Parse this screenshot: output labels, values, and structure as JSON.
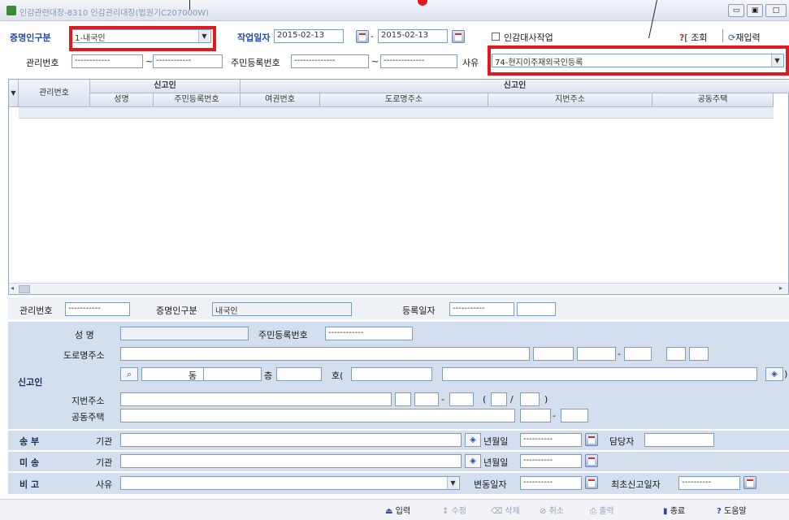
{
  "window": {
    "title": "인감관련대장-8310 인감관리대장(법원기C207000W)"
  },
  "top": {
    "cert_label": "증명인구분",
    "cert_value": "1-내국인",
    "workdate_label": "작업일자",
    "date_from": "2015-02-13",
    "date_sep": "-",
    "date_to": "2015-02-13",
    "seal_checkbox_label": "인감대사작업",
    "query_label": "조회",
    "reinput_label": "재입력",
    "mgmt_label": "관리번호",
    "mgmt_a": "------------",
    "mgmt_sep": "~",
    "mgmt_b": "------------",
    "rrn_label": "주민등록번호",
    "rrn_a": "--------------",
    "rrn_sep": "~",
    "rrn_b": "--------------",
    "reason_label": "사유",
    "reason_value": "74-현지이주재외국인등록"
  },
  "grid": {
    "group_reporter1": "신고인",
    "group_reporter2": "신고인",
    "col_mgmt": "관리번호",
    "col_name": "성명",
    "col_rrn": "주민등록번호",
    "col_passport": "여권번호",
    "col_road": "도로명주소",
    "col_lot": "지번주소",
    "col_apt": "공동주택"
  },
  "detail": {
    "mgmt_label": "관리번호",
    "mgmt_value": "-----------",
    "cert_label": "증명인구분",
    "cert_value": "내국인",
    "regdate_label": "등록일자",
    "regdate_value": "-----------",
    "reporter_label": "신고인",
    "name_label": "성      명",
    "rrn_label": "주민등록번호",
    "rrn_value": "------------",
    "road_label": "도로명주소",
    "road_sep": "-",
    "dong_label": "동",
    "floor_label": "층",
    "ho_label": "호(",
    "lot_label": "지번주소",
    "lot_sep": "-",
    "paren_open": "(",
    "slash": "/",
    "paren_close": ")",
    "apt_label": "공동주택",
    "apt_sep": "-",
    "send_label": "송 부",
    "send_org_label": "기관",
    "send_date_label": "년월일",
    "send_date": "----------",
    "send_person_label": "담당자",
    "recv_label": "미 송",
    "recv_org_label": "기관",
    "recv_date_label": "년월일",
    "recv_date": "----------",
    "note_label": "비 고",
    "note_reason_label": "사유",
    "change_date_label": "변동일자",
    "change_date": "----------",
    "first_date_label": "최초신고일자",
    "first_date": "----------"
  },
  "buttons": {
    "input": "입력",
    "edit": "수정",
    "delete": "삭제",
    "cancel": "취소",
    "print": "출력",
    "exit": "종료",
    "help": "도움말"
  }
}
